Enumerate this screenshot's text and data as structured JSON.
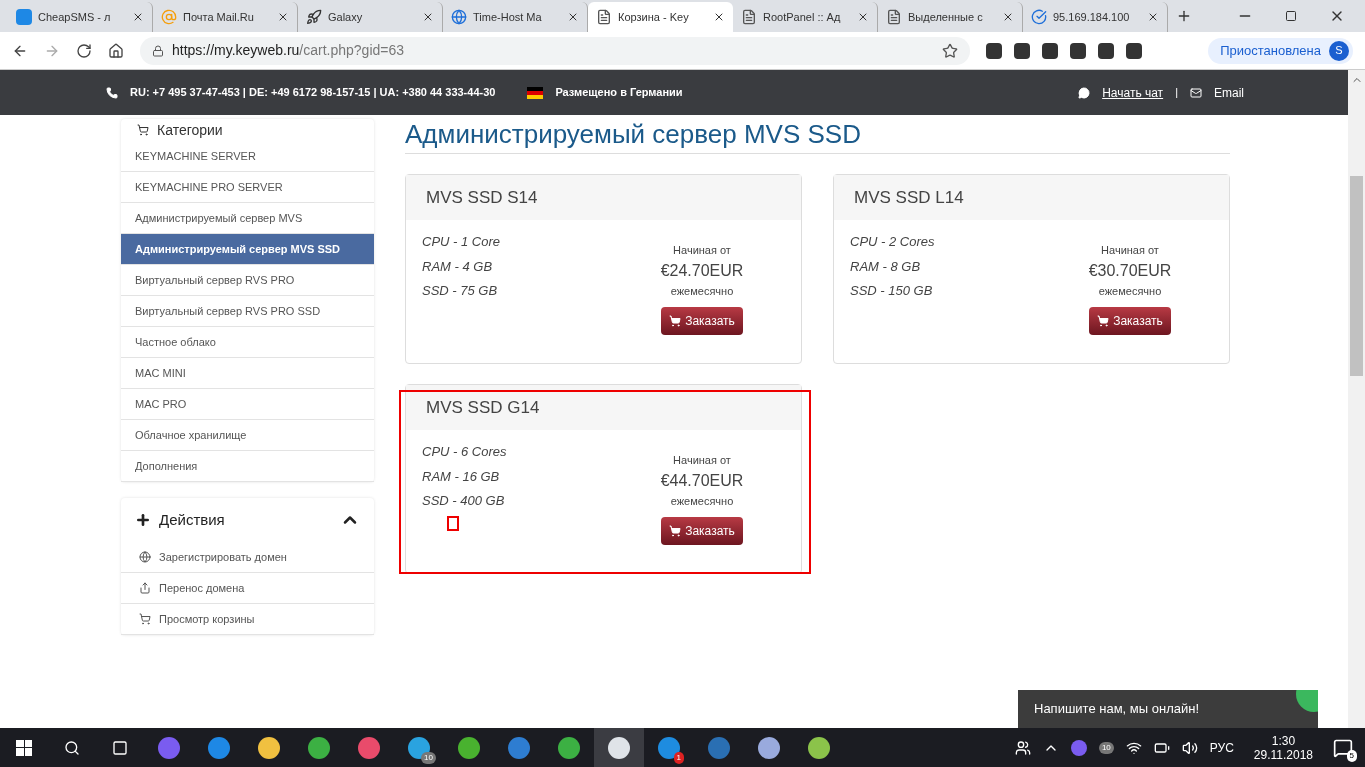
{
  "browser": {
    "tabs": [
      {
        "title": "CheapSMS - л",
        "selected": false
      },
      {
        "title": "Почта Mail.Ru",
        "selected": false
      },
      {
        "title": "Galaxy",
        "selected": false
      },
      {
        "title": "Time-Host Ma",
        "selected": false
      },
      {
        "title": "Корзина - Key",
        "selected": true
      },
      {
        "title": "RootPanel :: Ад",
        "selected": false
      },
      {
        "title": "Выделенные с",
        "selected": false
      },
      {
        "title": "95.169.184.100",
        "selected": false
      }
    ],
    "url_host": "https://my.keyweb.ru",
    "url_path": "/cart.php?gid=63",
    "profile_label": "Приостановлена",
    "profile_initial": "S"
  },
  "site_header": {
    "phones": "RU: +7 495 37-47-453 | DE: +49 6172 98-157-15 | UA: +380 44 333-44-30",
    "hosted": "Размещено в Германии",
    "chat": "Начать чат",
    "separator": "|",
    "email": "Email"
  },
  "sidebar": {
    "categories_title": "Категории",
    "categories": [
      {
        "label": "KEYMACHINE SERVER",
        "selected": false
      },
      {
        "label": "KEYMACHINE PRO SERVER",
        "selected": false
      },
      {
        "label": "Администрируемый сервер MVS",
        "selected": false
      },
      {
        "label": "Администрируемый сервер MVS SSD",
        "selected": true
      },
      {
        "label": "Виртуальный сервер RVS PRO",
        "selected": false
      },
      {
        "label": "Виртуальный сервер RVS PRO SSD",
        "selected": false
      },
      {
        "label": "Частное облако",
        "selected": false
      },
      {
        "label": "MAC MINI",
        "selected": false
      },
      {
        "label": "MAC PRO",
        "selected": false
      },
      {
        "label": "Облачное хранилище",
        "selected": false
      },
      {
        "label": "Дополнения",
        "selected": false
      }
    ],
    "actions_title": "Действия",
    "actions_expanded": true,
    "actions": [
      {
        "label": "Зарегистрировать домен"
      },
      {
        "label": "Перенос домена"
      },
      {
        "label": "Просмотр корзины"
      }
    ]
  },
  "main": {
    "title": "Администрируемый сервер MVS SSD",
    "products": [
      {
        "name": "MVS SSD S14",
        "features": [
          "CPU - 1 Core",
          "RAM - 4 GB",
          "SSD - 75 GB"
        ],
        "from": "Начиная от",
        "price": "€24.70EUR",
        "period": "ежемесячно",
        "button": "Заказать",
        "highlighted": false
      },
      {
        "name": "MVS SSD L14",
        "features": [
          "CPU - 2 Cores",
          "RAM - 8 GB",
          "SSD - 150 GB"
        ],
        "from": "Начиная от",
        "price": "€30.70EUR",
        "period": "ежемесячно",
        "button": "Заказать",
        "highlighted": false
      },
      {
        "name": "MVS SSD G14",
        "features": [
          "CPU - 6 Cores",
          "RAM - 16 GB",
          "SSD - 400 GB"
        ],
        "from": "Начиная от",
        "price": "€44.70EUR",
        "period": "ежемесячно",
        "button": "Заказать",
        "highlighted": true
      }
    ]
  },
  "chat_widget": {
    "text": "Напишите нам, мы онлайн!"
  },
  "taskbar": {
    "badges": [
      "10",
      "1",
      "10"
    ],
    "language": "РУС",
    "time": "1:30",
    "date": "29.11.2018",
    "notifications": "5"
  }
}
